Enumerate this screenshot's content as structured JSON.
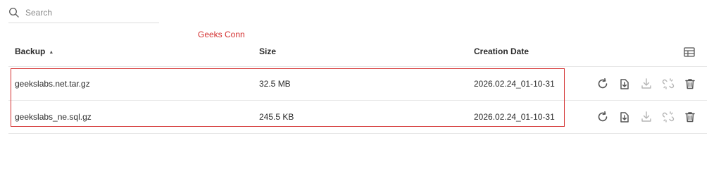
{
  "search": {
    "placeholder": "Search",
    "icon": "search-icon"
  },
  "annotation": "Geeks Conn",
  "table": {
    "columns": [
      {
        "label": "Backup",
        "sort": "ascending"
      },
      {
        "label": "Size"
      },
      {
        "label": "Creation Date"
      }
    ],
    "column_settings_icon": "table-columns-icon",
    "rows": [
      {
        "backup": "geekslabs.net.tar.gz",
        "size": "32.5 MB",
        "date": "2026.02.24_01-10-31"
      },
      {
        "backup": "geekslabs_ne.sql.gz",
        "size": "245.5 KB",
        "date": "2026.02.24_01-10-31"
      }
    ],
    "row_actions": [
      "restore-icon",
      "restore-to-file-icon",
      "download-icon",
      "unlink-icon",
      "delete-icon"
    ]
  },
  "colors": {
    "annotation": "#d32f2f",
    "icon": "#555555",
    "icon_disabled": "#b5b5b5",
    "divider": "#e6e6e6"
  }
}
